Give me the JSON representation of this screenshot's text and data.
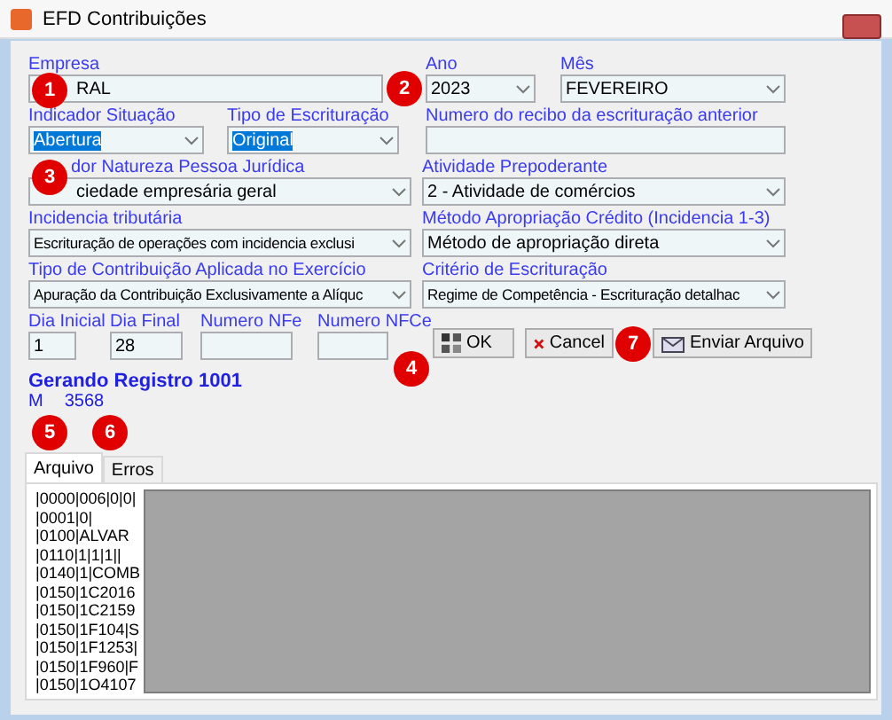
{
  "window": {
    "title": "EFD Contribuições"
  },
  "rows": [
    [
      {
        "label": "Empresa",
        "value": "RAL",
        "kind": "text",
        "highlighted": false
      },
      {
        "label": "Ano",
        "value": "2023",
        "kind": "combo",
        "highlighted": false
      },
      {
        "label": "Mês",
        "value": "FEVEREIRO",
        "kind": "combo",
        "highlighted": false
      }
    ],
    [
      {
        "label": "Indicador Situação",
        "value": "Abertura",
        "kind": "combo",
        "highlighted": true
      },
      {
        "label": "Tipo de Escrituração",
        "value": "Original",
        "kind": "combo",
        "highlighted": true
      },
      {
        "label": "Numero do recibo da escrituração anterior",
        "kind": "text"
      }
    ],
    [
      {
        "label": "dor Natureza Pessoa Jurídica",
        "value": "ciedade empresária geral",
        "kind": "combo",
        "highlighted": false
      },
      {
        "label": "Atividade Prepoderante",
        "value": "2 -  Atividade de comércios",
        "kind": "combo",
        "highlighted": false
      }
    ],
    [
      {
        "label": "Incidencia tributária",
        "value": "Escrituração de operações com incidencia exclusi",
        "kind": "combo",
        "highlighted": false
      },
      {
        "label": "Método Apropriação Crédito (Incidencia 1-3)",
        "value": "Método de apropriação direta",
        "kind": "combo",
        "highlighted": false
      }
    ],
    [
      {
        "label": "Tipo de Contribuição Aplicada no Exercício",
        "value": "Apuração da Contribuição Exclusivamente a Alíquc",
        "kind": "combo",
        "highlighted": false
      },
      {
        "label": "Critério de Escrituração",
        "value": "Regime de Competência - Escrituração detalhac",
        "kind": "combo",
        "highlighted": false
      }
    ],
    [
      {
        "label": "Dia Inicial",
        "value": "1",
        "kind": "text",
        "highlighted": false
      },
      {
        "label": "Dia Final",
        "value": "28",
        "kind": "text",
        "highlighted": false
      },
      {
        "label": "Numero NFe",
        "kind": "text"
      },
      {
        "label": "Numero NFCe",
        "kind": "text"
      }
    ]
  ],
  "buttons": [
    {
      "label": "OK",
      "kind": "ok"
    },
    {
      "label": "Cancel",
      "kind": "cancel"
    },
    {
      "label": "Enviar Arquivo",
      "kind": "send"
    }
  ],
  "status": {
    "title": "Gerando Registro 1001",
    "detail": [
      "M",
      "3568"
    ]
  },
  "tabs": [
    {
      "label": "Arquivo",
      "selected": true
    },
    {
      "label": "Erros",
      "selected": false
    }
  ],
  "log_lines": [
    "|0000|006|0|0|",
    "|0001|0|",
    "|0100|ALVAR",
    "|0110|1|1|1||",
    "|0140|1|COMB",
    "|0150|1C2016",
    "|0150|1C2159",
    "|0150|1F104|S",
    "|0150|1F1253|",
    "|0150|1F960|F",
    "|0150|1O4107"
  ],
  "callouts": [
    {
      "label": "1"
    },
    {
      "label": "2"
    },
    {
      "label": "3"
    },
    {
      "label": "4"
    },
    {
      "label": "5"
    },
    {
      "label": "6"
    },
    {
      "label": "7"
    }
  ]
}
